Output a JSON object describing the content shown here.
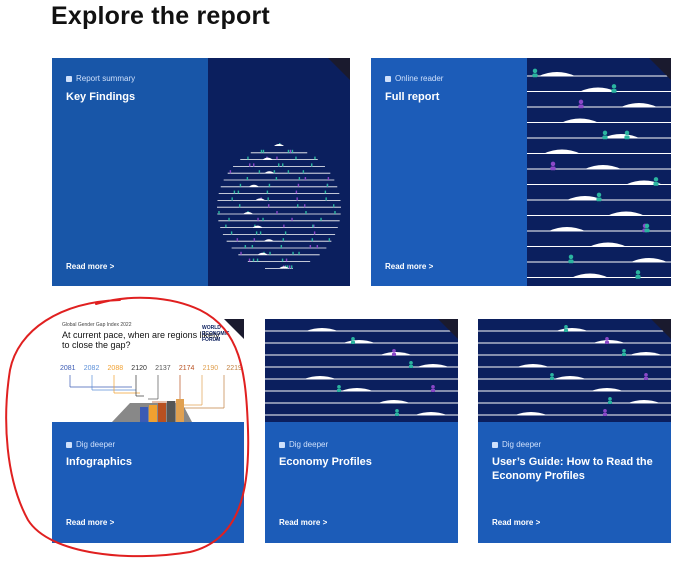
{
  "heading": "Explore the report",
  "cards": [
    {
      "label": "Report summary",
      "title": "Key Findings",
      "more": "Read more >"
    },
    {
      "label": "Online reader",
      "title": "Full report",
      "more": "Read more >"
    },
    {
      "label": "Dig deeper",
      "title": "Infographics",
      "more": "Read more >"
    },
    {
      "label": "Dig deeper",
      "title": "Economy Profiles",
      "more": "Read more >"
    },
    {
      "label": "Dig deeper",
      "title": "User’s Guide: How to Read the Economy Profiles",
      "more": "Read more >"
    }
  ],
  "infographic": {
    "source": "Global Gender Gap Index 2022",
    "question": "At current pace, when are regions likely to close the gap?",
    "years": [
      "2081",
      "2082",
      "2088",
      "2120",
      "2137",
      "2174",
      "2190",
      "2219"
    ],
    "year_colors": [
      "#3b5bb5",
      "#5b8fd8",
      "#f0a030",
      "#333333",
      "#555555",
      "#b85020",
      "#e0a050",
      "#c08040"
    ],
    "logo_text": "WORLD ECONOMIC FORUM"
  },
  "colors": {
    "accent": "#1c5cb8",
    "dark_art": "#0b1f5e",
    "annotation": "#e02020"
  }
}
